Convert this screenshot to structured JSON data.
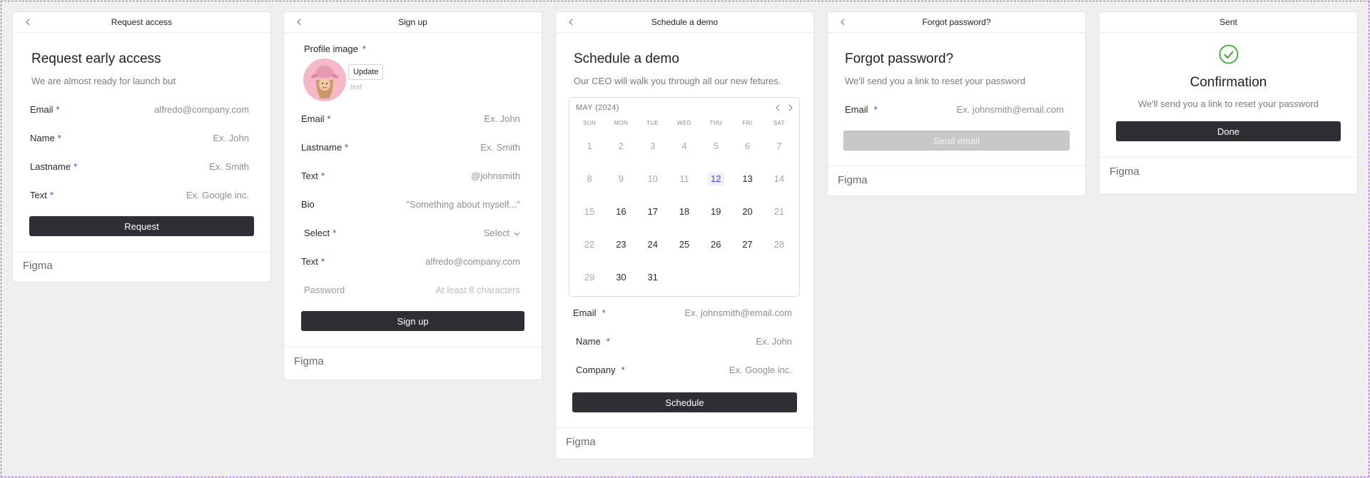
{
  "card1": {
    "header": "Request access",
    "title": "Request early access",
    "subtitle": "We are almost ready for launch but",
    "fields": [
      {
        "label": "Email",
        "required": "*",
        "placeholder": "alfredo@company.com"
      },
      {
        "label": "Name",
        "required": "*",
        "placeholder": "Ex. John"
      },
      {
        "label": "Lastname",
        "required": "*",
        "placeholder": "Ex. Smith"
      },
      {
        "label": "Text",
        "required": "*",
        "placeholder": "Ex. Google inc."
      }
    ],
    "button": "Request",
    "footer": "Figma"
  },
  "card2": {
    "header": "Sign up",
    "profile_label": "Profile image",
    "profile_required": "*",
    "update_button": "Update",
    "update_hint": "text",
    "fields": [
      {
        "label": "Email",
        "required": "*",
        "placeholder": "Ex. John"
      },
      {
        "label": "Lastname",
        "required": "*",
        "placeholder": "Ex. Smith"
      },
      {
        "label": "Text",
        "required": "*",
        "placeholder": "@johnsmith"
      },
      {
        "label": "Bio",
        "required": "",
        "placeholder": "\"Something about myself...\""
      },
      {
        "label": "Select",
        "required": "*",
        "placeholder": "Select"
      },
      {
        "label": "Text",
        "required": "*",
        "placeholder": "alfredo@company.com"
      }
    ],
    "password_label": "Password",
    "password_placeholder": "At least 8 characters",
    "button": "Sign up",
    "footer": "Figma"
  },
  "card3": {
    "header": "Schedule a demo",
    "title": "Schedule a demo",
    "subtitle": "Our CEO will walk you through all our new fetures.",
    "calendar": {
      "month": "MAY (2024)",
      "weekdays": [
        "SUN",
        "MON",
        "TUE",
        "WED",
        "THU",
        "FRI",
        "SAT"
      ],
      "days": [
        {
          "d": "1",
          "m": true
        },
        {
          "d": "2",
          "m": true
        },
        {
          "d": "3",
          "m": true
        },
        {
          "d": "4",
          "m": true
        },
        {
          "d": "5",
          "m": true
        },
        {
          "d": "6",
          "m": true
        },
        {
          "d": "7",
          "m": true
        },
        {
          "d": "8",
          "m": true
        },
        {
          "d": "9",
          "m": true
        },
        {
          "d": "10",
          "m": true
        },
        {
          "d": "11",
          "m": true
        },
        {
          "d": "12",
          "sel": true
        },
        {
          "d": "13"
        },
        {
          "d": "14",
          "m": true
        },
        {
          "d": "15",
          "m": true
        },
        {
          "d": "16"
        },
        {
          "d": "17"
        },
        {
          "d": "18"
        },
        {
          "d": "19"
        },
        {
          "d": "20"
        },
        {
          "d": "21",
          "m": true
        },
        {
          "d": "22",
          "m": true
        },
        {
          "d": "23"
        },
        {
          "d": "24"
        },
        {
          "d": "25"
        },
        {
          "d": "26"
        },
        {
          "d": "27"
        },
        {
          "d": "28",
          "m": true
        },
        {
          "d": "29",
          "m": true
        },
        {
          "d": "30"
        },
        {
          "d": "31"
        }
      ],
      "selected": "12"
    },
    "fields": [
      {
        "label": "Email",
        "required": "*",
        "placeholder": "Ex. johnsmith@email.com"
      },
      {
        "label": "Name",
        "required": "*",
        "placeholder": "Ex. John"
      },
      {
        "label": "Company",
        "required": "*",
        "placeholder": "Ex. Google inc."
      }
    ],
    "button": "Schedule",
    "footer": "Figma"
  },
  "card4": {
    "header": "Forgot password?",
    "title": "Forgot password?",
    "subtitle": "We'll send you a link to reset your password",
    "field": {
      "label": "Email",
      "required": "*",
      "placeholder": "Ex. johnsmith@email.com"
    },
    "button": "Send email",
    "footer": "Figma"
  },
  "card5": {
    "header": "Sent",
    "title": "Confirmation",
    "subtitle": "We'll send you a link to reset your password",
    "button": "Done",
    "footer": "Figma"
  },
  "colors": {
    "accent": "#4a3fe0",
    "button": "#2d2f35",
    "success": "#3aaa35",
    "avatar_bg": "#f4b8c6"
  },
  "icons": [
    "back-chevron-icon",
    "chevron-left-icon",
    "chevron-right-icon",
    "chevron-down-icon",
    "check-circle-icon"
  ]
}
